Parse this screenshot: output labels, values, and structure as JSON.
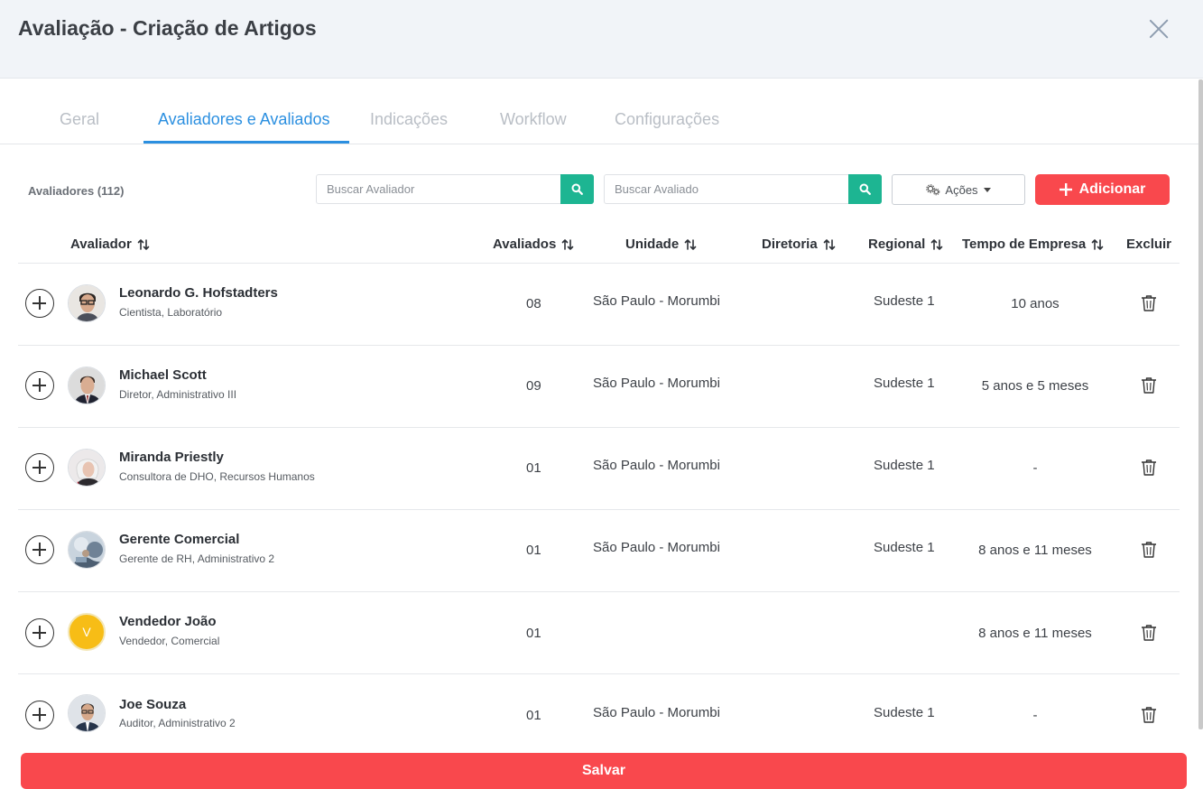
{
  "modal": {
    "title": "Avaliação - Criação de Artigos"
  },
  "tabs": [
    {
      "label": "Geral",
      "active": false
    },
    {
      "label": "Avaliadores e Avaliados",
      "active": true
    },
    {
      "label": "Indicações",
      "active": false
    },
    {
      "label": "Workflow",
      "active": false
    },
    {
      "label": "Configurações",
      "active": false
    }
  ],
  "toolbar": {
    "count_label": "Avaliadores (112)",
    "search_avaliador_placeholder": "Buscar Avaliador",
    "search_avaliado_placeholder": "Buscar Avaliado",
    "acoes_label": "Ações",
    "adicionar_label": "Adicionar"
  },
  "table": {
    "headers": [
      "Avaliador",
      "Avaliados",
      "Unidade",
      "Diretoria",
      "Regional",
      "Tempo de Empresa",
      "Excluir"
    ],
    "rows": [
      {
        "name": "Leonardo G. Hofstadters",
        "role": "Cientista, Laboratório",
        "avaliados": "08",
        "unidade": "São Paulo - Morumbi",
        "diretoria": "",
        "regional": "Sudeste 1",
        "tempo": "10 anos",
        "avatar": "photo"
      },
      {
        "name": "Michael Scott",
        "role": "Diretor, Administrativo III",
        "avaliados": "09",
        "unidade": "São Paulo - Morumbi",
        "diretoria": "",
        "regional": "Sudeste 1",
        "tempo": "5 anos e 5 meses",
        "avatar": "photo"
      },
      {
        "name": "Miranda Priestly",
        "role": "Consultora de DHO, Recursos Humanos",
        "avaliados": "01",
        "unidade": "São Paulo - Morumbi",
        "diretoria": "",
        "regional": "Sudeste 1",
        "tempo": "-",
        "avatar": "photo"
      },
      {
        "name": "Gerente Comercial",
        "role": "Gerente de RH, Administrativo 2",
        "avaliados": "01",
        "unidade": "São Paulo - Morumbi",
        "diretoria": "",
        "regional": "Sudeste 1",
        "tempo": "8 anos e 11 meses",
        "avatar": "photo"
      },
      {
        "name": "Vendedor João",
        "role": "Vendedor, Comercial",
        "avaliados": "01",
        "unidade": "",
        "diretoria": "",
        "regional": "",
        "tempo": "8 anos e 11 meses",
        "avatar": "V"
      },
      {
        "name": "Joe Souza",
        "role": "Auditor, Administrativo 2",
        "avaliados": "01",
        "unidade": "São Paulo - Morumbi",
        "diretoria": "",
        "regional": "Sudeste 1",
        "tempo": "-",
        "avatar": "photo"
      }
    ]
  },
  "footer": {
    "save_label": "Salvar"
  },
  "colors": {
    "accent": "#2b8fe0",
    "search_button": "#1db592",
    "primary_button": "#f9484d",
    "avatar_letter_bg": "#f7bd16"
  },
  "icons": {
    "close": "close-icon",
    "search": "search-icon",
    "gears": "gears-icon",
    "plus": "plus-icon",
    "sort": "sort-icon",
    "expand": "plus-circle-icon",
    "trash": "trash-icon"
  }
}
